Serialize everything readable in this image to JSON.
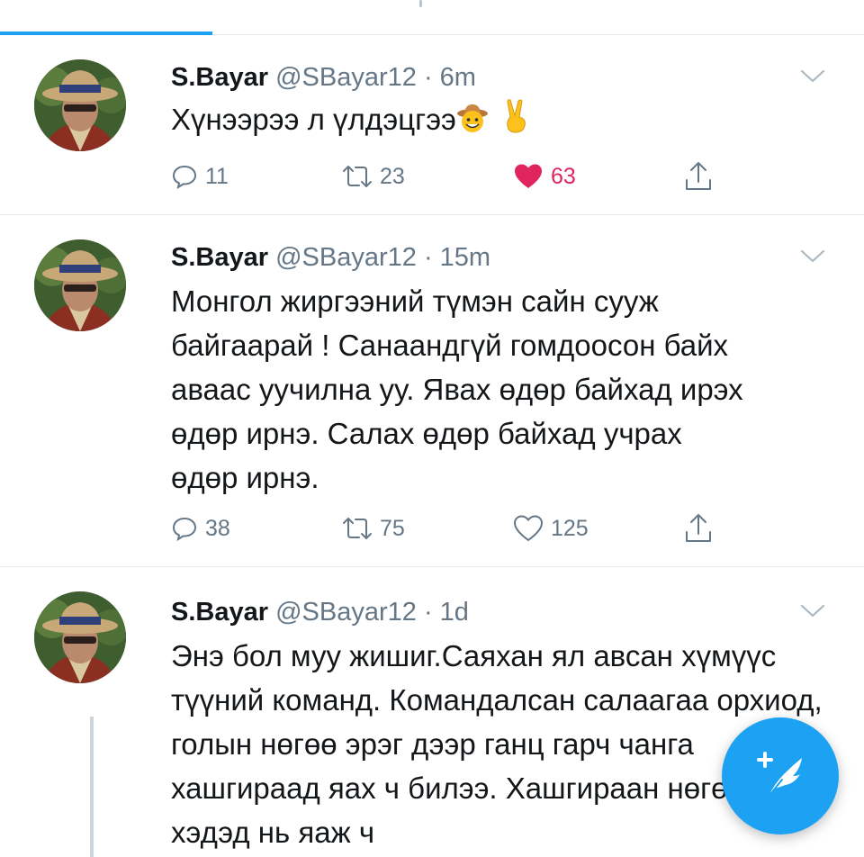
{
  "colors": {
    "accent": "#1da1f2",
    "like": "#e0245e",
    "secondary_text": "#657786"
  },
  "tweets": [
    {
      "name": "S.Bayar",
      "handle": "@SBayar12",
      "separator": "·",
      "time": "6m",
      "text": "Хүнээрээ л үлдэцгээ",
      "emojis": [
        "cowboy-face-emoji",
        "victory-hand-emoji"
      ],
      "replies": "11",
      "retweets": "23",
      "likes": "63",
      "liked": true
    },
    {
      "name": "S.Bayar",
      "handle": "@SBayar12",
      "separator": "·",
      "time": "15m",
      "text": "Монгол жиргээний түмэн сайн сууж байгаарай ! Санаандгүй гомдоосон байх аваас уучилна уу. Явах өдөр байхад ирэх өдөр ирнэ. Салах өдөр байхад учрах өдөр ирнэ.",
      "replies": "38",
      "retweets": "75",
      "likes": "125",
      "liked": false
    },
    {
      "name": "S.Bayar",
      "handle": "@SBayar12",
      "separator": "·",
      "time": "1d",
      "text": "Энэ бол муу жишиг.Саяхан ял авсан хүмүүс түүний команд. Командалсан салаагаа орхиод, голын нөгөө эрэг дээр ганц гарч чанга хашгираад яах ч билээ. Хашгираан нөгөө хэдэд нь яаж ч"
    }
  ],
  "compose_button": {
    "icon": "compose-tweet-icon"
  }
}
